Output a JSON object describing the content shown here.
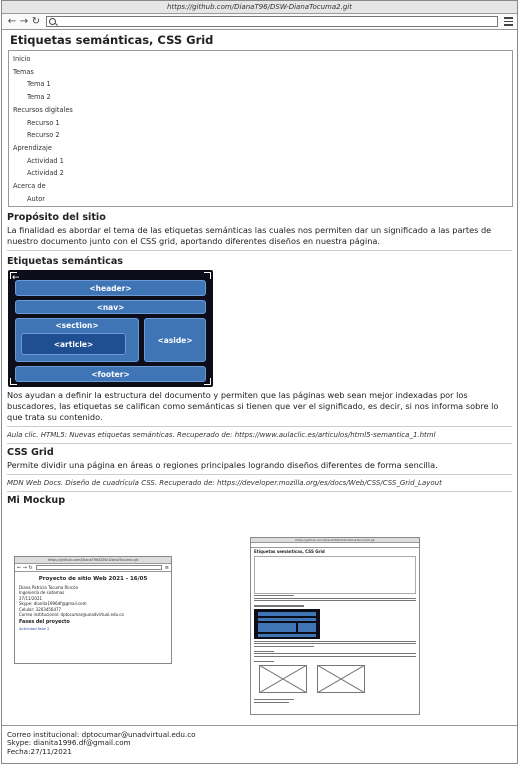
{
  "browser": {
    "url_title": "https://github.com/DianaT96/DSW-DianaTocuma2.git",
    "address_value": ""
  },
  "page": {
    "title": "Etiquetas semánticas, CSS Grid"
  },
  "nav": {
    "items": [
      {
        "label": "Inicio",
        "sub": false
      },
      {
        "label": "Temas",
        "sub": false
      },
      {
        "label": "Tema 1",
        "sub": true
      },
      {
        "label": "Tema 2",
        "sub": true
      },
      {
        "label": "Recursos digitales",
        "sub": false
      },
      {
        "label": "Recurso 1",
        "sub": true
      },
      {
        "label": "Recurso 2",
        "sub": true
      },
      {
        "label": "Aprendizaje",
        "sub": false
      },
      {
        "label": "Actividad 1",
        "sub": true
      },
      {
        "label": "Actividad 2",
        "sub": true
      },
      {
        "label": "Acerca de",
        "sub": false
      },
      {
        "label": "Autor",
        "sub": true
      }
    ]
  },
  "proposito": {
    "heading": "Propósito del sitio",
    "text": "La finalidad es abordar el tema de las etiquetas semánticas las cuales nos permiten dar un significado a las partes de nuestro documento junto con el CSS grid, aportando diferentes diseños en nuestra página."
  },
  "semanticas": {
    "heading": "Etiquetas semánticas",
    "figure": {
      "header": "<header>",
      "nav": "<nav>",
      "section": "<section>",
      "article": "<article>",
      "aside": "<aside>",
      "footer": "<footer>"
    },
    "text": "Nos ayudan a definir la estructura del documento y permiten que las páginas web sean mejor indexadas por los buscadores, las etiquetas se califican como semánticas si tienen que ver el significado, es decir, si nos informa sobre lo que trata su contenido.",
    "reference": "Aula clic. HTML5: Nuevas etiquetas semánticas. Recuperado de: https://www.aulaclic.es/articulos/html5-semantica_1.html"
  },
  "cssgrid": {
    "heading": "CSS Grid",
    "text": "Permite dividir una página en áreas o regiones principales logrando diseños diferentes de forma sencilla.",
    "reference": "MDN Web Docs. Diseño de cuadrícula CSS. Recuperado de: https://developer.mozilla.org/es/docs/Web/CSS/CSS_Grid_Layout"
  },
  "mockup": {
    "heading": "Mi Mockup",
    "thumb1": {
      "bar": "https://github.com/DianaT96/DSW-DianaTocuma.git",
      "title": "Proyecto de sitio Web 2021 - 16/05",
      "lines": [
        "Diana Patricia Tocuma Rincón",
        "Ingeniería de sistemas",
        "27/11/2021",
        "Skype: dianita1996df@gmail.com",
        "Celular: 3203456477",
        "Correo institucional: dptocumar@unadvirtual.edu.co"
      ],
      "subheading": "Fases del proyecto",
      "link": "Actividad fase 2"
    },
    "thumb2": {
      "bar": "https://github.com/DianaT96/DSW-DianaTocuma2.git",
      "title": "Etiquetas semánticas, CSS Grid"
    }
  },
  "footer": {
    "correo": "Correo institucional: dptocumar@unadvirtual.edu.co",
    "skype": "Skype: dianita1996.df@gmail.com",
    "fecha": "Fecha:27/11/2021"
  }
}
